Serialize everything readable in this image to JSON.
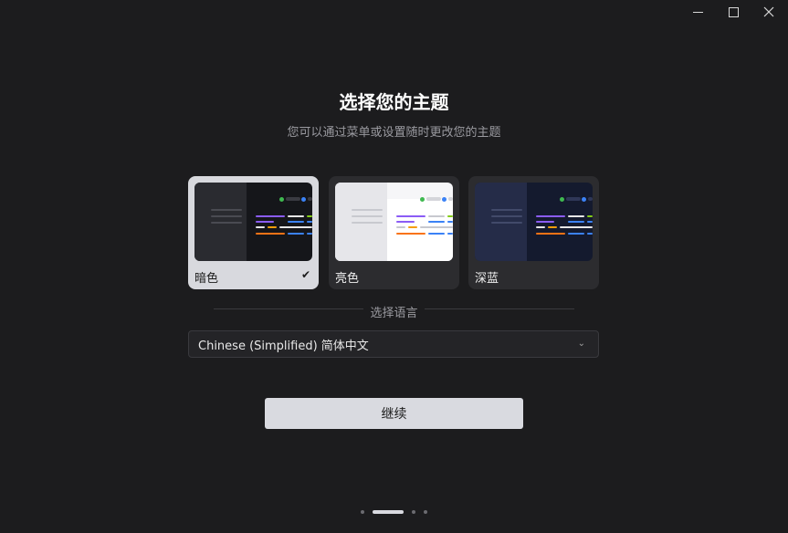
{
  "window": {
    "minimize_icon": "minimize-icon",
    "maximize_icon": "maximize-icon",
    "close_icon": "close-icon",
    "close_glyph": "✕"
  },
  "header": {
    "title": "选择您的主题",
    "subtitle": "您可以通过菜单或设置随时更改您的主题"
  },
  "themes": [
    {
      "label": "暗色",
      "selected": true,
      "check": "✔"
    },
    {
      "label": "亮色",
      "selected": false
    },
    {
      "label": "深蓝",
      "selected": false
    }
  ],
  "language": {
    "section_label": "选择语言",
    "selected": "Chinese (Simplified) 简体中文",
    "chevron": "⌄"
  },
  "continue_label": "继续",
  "pager": {
    "count": 4,
    "active": 1
  }
}
